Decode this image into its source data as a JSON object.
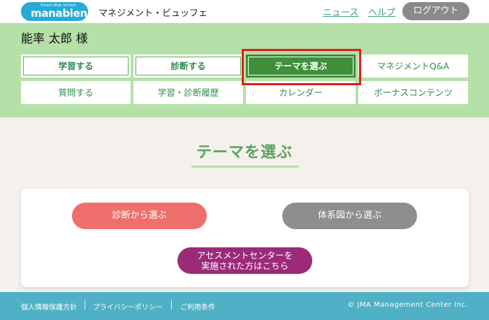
{
  "header": {
    "logo_tagline": "Smart Web School",
    "logo_text": "manabien",
    "service_name": "マネジメント・ビュッフェ",
    "news_link": "ニュース",
    "help_link": "ヘルプ",
    "logout_label": "ログアウト"
  },
  "member": {
    "user_name": "能率 太郎 様"
  },
  "menu": {
    "items": [
      {
        "label": "学習する"
      },
      {
        "label": "診断する"
      },
      {
        "label": "テーマを選ぶ"
      },
      {
        "label": "マネジメントQ&A"
      },
      {
        "label": "質問する"
      },
      {
        "label": "学習・診断履歴"
      },
      {
        "label": "カレンダー"
      },
      {
        "label": "ボーナスコンテンツ"
      }
    ],
    "active_item": "テーマを選ぶ"
  },
  "main": {
    "section_title": "テーマを選ぶ",
    "diagnosis_button": "診断から選ぶ",
    "system_button": "体系図から選ぶ",
    "assessment_button_line1": "アセスメントセンターを",
    "assessment_button_line2": "実施された方はこちら"
  },
  "footer": {
    "links": [
      "個人情報保護方針",
      "プライバシーポリシー",
      "ご利用条件"
    ],
    "copyright": "© JMA Management Center Inc."
  },
  "colors": {
    "brand_blue": "#29a9d6",
    "band_green": "#b5e0a7",
    "active_green": "#3f8f3c",
    "highlight_red": "#e41b1b",
    "diagnosis_pink": "#ef6f6d",
    "system_gray": "#8e8e8e",
    "assessment_purple": "#9b2a79",
    "footer_teal": "#4fb0c6"
  }
}
